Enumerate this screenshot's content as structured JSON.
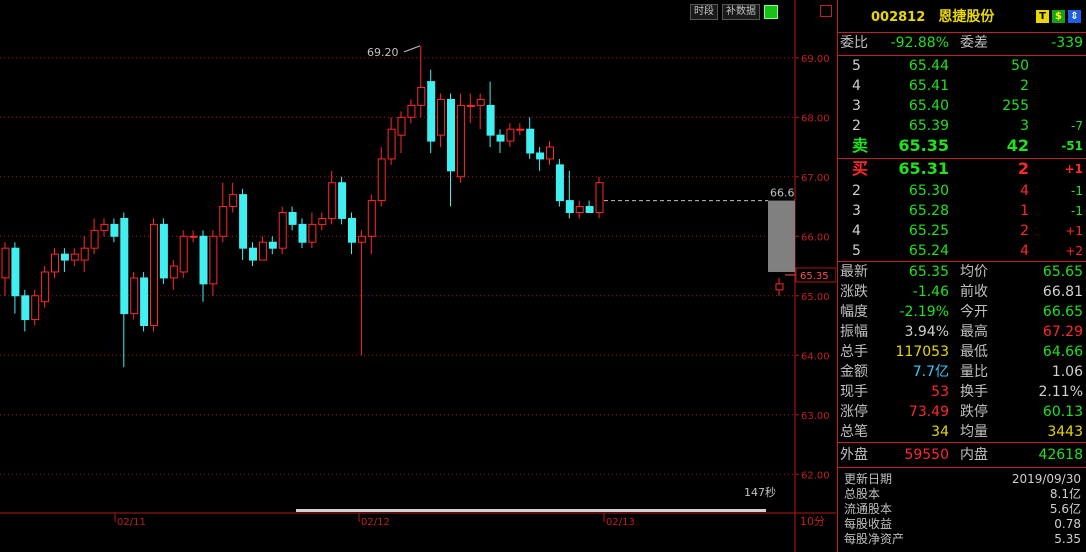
{
  "toolbar": {
    "period_label": "时段",
    "fill_data_label": "补数据"
  },
  "header": {
    "code": "002812",
    "name": "恩捷股份",
    "icons": [
      "T-icon",
      "green-dollar-icon",
      "blue-arrow-icon"
    ]
  },
  "chart_data": {
    "type": "candlestick",
    "ylim": [
      61.5,
      69.4
    ],
    "y_ticks": [
      "69.00",
      "68.00",
      "67.00",
      "66.00",
      "65.00",
      "64.00",
      "63.00",
      "62.00"
    ],
    "x_labels": [
      "02/11",
      "02/12",
      "02/13"
    ],
    "period_label": "10分",
    "countdown": "147秒",
    "max_label": "69.20",
    "current_price_label": "65.35",
    "dashed_label": "66.6",
    "bars": [
      {
        "o": 65.3,
        "c": 65.8,
        "h": 65.9,
        "l": 65.0
      },
      {
        "o": 65.8,
        "c": 65.0,
        "h": 65.9,
        "l": 64.7
      },
      {
        "o": 65.0,
        "c": 64.6,
        "h": 65.1,
        "l": 64.4
      },
      {
        "o": 64.6,
        "c": 65.0,
        "h": 65.1,
        "l": 64.5
      },
      {
        "o": 64.9,
        "c": 65.4,
        "h": 65.5,
        "l": 64.8
      },
      {
        "o": 65.4,
        "c": 65.7,
        "h": 65.8,
        "l": 65.3
      },
      {
        "o": 65.7,
        "c": 65.6,
        "h": 65.8,
        "l": 65.4
      },
      {
        "o": 65.6,
        "c": 65.7,
        "h": 65.8,
        "l": 65.5
      },
      {
        "o": 65.6,
        "c": 65.8,
        "h": 66.0,
        "l": 65.4
      },
      {
        "o": 65.8,
        "c": 66.1,
        "h": 66.3,
        "l": 65.7
      },
      {
        "o": 66.1,
        "c": 66.2,
        "h": 66.3,
        "l": 66.0
      },
      {
        "o": 66.2,
        "c": 66.0,
        "h": 66.3,
        "l": 65.9
      },
      {
        "o": 66.3,
        "c": 64.7,
        "h": 66.4,
        "l": 63.8
      },
      {
        "o": 64.7,
        "c": 65.3,
        "h": 65.4,
        "l": 64.6
      },
      {
        "o": 65.3,
        "c": 64.5,
        "h": 65.4,
        "l": 64.4
      },
      {
        "o": 64.5,
        "c": 66.2,
        "h": 66.3,
        "l": 64.4
      },
      {
        "o": 66.2,
        "c": 65.3,
        "h": 66.3,
        "l": 65.2
      },
      {
        "o": 65.3,
        "c": 65.5,
        "h": 65.6,
        "l": 65.1
      },
      {
        "o": 65.4,
        "c": 66.0,
        "h": 66.1,
        "l": 65.3
      },
      {
        "o": 66.0,
        "c": 66.0,
        "h": 66.1,
        "l": 65.9
      },
      {
        "o": 66.0,
        "c": 65.2,
        "h": 66.1,
        "l": 64.9
      },
      {
        "o": 65.2,
        "c": 66.0,
        "h": 66.1,
        "l": 65.0
      },
      {
        "o": 66.0,
        "c": 66.5,
        "h": 66.9,
        "l": 65.9
      },
      {
        "o": 66.5,
        "c": 66.7,
        "h": 66.9,
        "l": 66.4
      },
      {
        "o": 66.7,
        "c": 65.8,
        "h": 66.8,
        "l": 65.6
      },
      {
        "o": 65.8,
        "c": 65.6,
        "h": 65.9,
        "l": 65.5
      },
      {
        "o": 65.6,
        "c": 65.9,
        "h": 66.0,
        "l": 65.6
      },
      {
        "o": 65.9,
        "c": 65.8,
        "h": 66.0,
        "l": 65.7
      },
      {
        "o": 65.8,
        "c": 66.4,
        "h": 66.5,
        "l": 65.7
      },
      {
        "o": 66.4,
        "c": 66.2,
        "h": 66.5,
        "l": 66.1
      },
      {
        "o": 66.2,
        "c": 65.9,
        "h": 66.3,
        "l": 65.8
      },
      {
        "o": 65.9,
        "c": 66.2,
        "h": 66.4,
        "l": 65.8
      },
      {
        "o": 66.2,
        "c": 66.3,
        "h": 66.4,
        "l": 66.1
      },
      {
        "o": 66.3,
        "c": 66.9,
        "h": 67.1,
        "l": 66.2
      },
      {
        "o": 66.9,
        "c": 66.3,
        "h": 67.0,
        "l": 66.2
      },
      {
        "o": 66.3,
        "c": 65.9,
        "h": 66.4,
        "l": 65.7
      },
      {
        "o": 65.9,
        "c": 66.0,
        "h": 66.1,
        "l": 64.0
      },
      {
        "o": 66.0,
        "c": 66.6,
        "h": 66.7,
        "l": 65.7
      },
      {
        "o": 66.6,
        "c": 67.3,
        "h": 67.5,
        "l": 66.5
      },
      {
        "o": 67.3,
        "c": 67.8,
        "h": 68.0,
        "l": 67.2
      },
      {
        "o": 67.7,
        "c": 68.0,
        "h": 68.1,
        "l": 67.4
      },
      {
        "o": 68.0,
        "c": 68.2,
        "h": 68.3,
        "l": 67.9
      },
      {
        "o": 68.2,
        "c": 68.5,
        "h": 69.2,
        "l": 68.0
      },
      {
        "o": 68.6,
        "c": 67.6,
        "h": 68.8,
        "l": 67.4
      },
      {
        "o": 67.7,
        "c": 68.3,
        "h": 68.4,
        "l": 67.5
      },
      {
        "o": 68.3,
        "c": 67.1,
        "h": 68.4,
        "l": 66.5
      },
      {
        "o": 67.0,
        "c": 68.2,
        "h": 68.4,
        "l": 66.9
      },
      {
        "o": 68.2,
        "c": 68.2,
        "h": 68.4,
        "l": 67.9
      },
      {
        "o": 68.2,
        "c": 68.3,
        "h": 68.4,
        "l": 67.8
      },
      {
        "o": 68.2,
        "c": 67.7,
        "h": 68.6,
        "l": 67.5
      },
      {
        "o": 67.7,
        "c": 67.6,
        "h": 67.8,
        "l": 67.4
      },
      {
        "o": 67.6,
        "c": 67.8,
        "h": 67.9,
        "l": 67.5
      },
      {
        "o": 67.8,
        "c": 67.8,
        "h": 67.9,
        "l": 67.7
      },
      {
        "o": 67.8,
        "c": 67.4,
        "h": 68.0,
        "l": 67.3
      },
      {
        "o": 67.4,
        "c": 67.3,
        "h": 67.5,
        "l": 67.1
      },
      {
        "o": 67.3,
        "c": 67.5,
        "h": 67.6,
        "l": 67.2
      },
      {
        "o": 67.2,
        "c": 66.6,
        "h": 67.3,
        "l": 66.5
      },
      {
        "o": 66.6,
        "c": 66.4,
        "h": 67.1,
        "l": 66.3
      },
      {
        "o": 66.4,
        "c": 66.5,
        "h": 66.6,
        "l": 66.3
      },
      {
        "o": 66.5,
        "c": 66.4,
        "h": 66.6,
        "l": 66.4
      },
      {
        "o": 66.4,
        "c": 66.9,
        "h": 67.0,
        "l": 66.3
      },
      {
        "o": 65.1,
        "c": 65.2,
        "h": 65.3,
        "l": 65.0
      }
    ]
  },
  "order_book": {
    "ratio_label": "委比",
    "ratio": "-92.88%",
    "diff_label": "委差",
    "diff": "-339",
    "asks": [
      {
        "level": "5",
        "price": "65.44",
        "vol": "50",
        "chg": ""
      },
      {
        "level": "4",
        "price": "65.41",
        "vol": "2",
        "chg": ""
      },
      {
        "level": "3",
        "price": "65.40",
        "vol": "255",
        "chg": ""
      },
      {
        "level": "2",
        "price": "65.39",
        "vol": "3",
        "chg": "-7"
      },
      {
        "level": "卖",
        "price": "65.35",
        "vol": "42",
        "chg": "-51"
      }
    ],
    "bids": [
      {
        "level": "买",
        "price": "65.31",
        "vol": "2",
        "chg": "+1"
      },
      {
        "level": "2",
        "price": "65.30",
        "vol": "4",
        "chg": "-1"
      },
      {
        "level": "3",
        "price": "65.28",
        "vol": "1",
        "chg": "-1"
      },
      {
        "level": "4",
        "price": "65.25",
        "vol": "2",
        "chg": "+1"
      },
      {
        "level": "5",
        "price": "65.24",
        "vol": "4",
        "chg": "+2"
      }
    ]
  },
  "quote": [
    {
      "l1": "最新",
      "v1": "65.35",
      "c1": "g",
      "l2": "均价",
      "v2": "65.65",
      "c2": "g"
    },
    {
      "l1": "涨跌",
      "v1": "-1.46",
      "c1": "g",
      "l2": "前收",
      "v2": "66.81",
      "c2": "w"
    },
    {
      "l1": "幅度",
      "v1": "-2.19%",
      "c1": "g",
      "l2": "今开",
      "v2": "66.65",
      "c2": "g"
    },
    {
      "l1": "振幅",
      "v1": "3.94%",
      "c1": "w",
      "l2": "最高",
      "v2": "67.29",
      "c2": "r"
    },
    {
      "l1": "总手",
      "v1": "117053",
      "c1": "y",
      "l2": "最低",
      "v2": "64.66",
      "c2": "g"
    },
    {
      "l1": "金额",
      "v1": "7.7亿",
      "c1": "c",
      "l2": "量比",
      "v2": "1.06",
      "c2": "w"
    },
    {
      "l1": "现手",
      "v1": "53",
      "c1": "r",
      "l2": "换手",
      "v2": "2.11%",
      "c2": "w"
    },
    {
      "l1": "涨停",
      "v1": "73.49",
      "c1": "r",
      "l2": "跌停",
      "v2": "60.13",
      "c2": "g"
    },
    {
      "l1": "总笔",
      "v1": "34",
      "c1": "y",
      "l2": "均量",
      "v2": "3443",
      "c2": "y"
    }
  ],
  "outer_inner": {
    "out_label": "外盘",
    "out": "59550",
    "in_label": "内盘",
    "in": "42618"
  },
  "info": [
    {
      "label": "更新日期",
      "value": "2019/09/30"
    },
    {
      "label": "总股本",
      "value": "8.1亿"
    },
    {
      "label": "流通股本",
      "value": "5.6亿"
    },
    {
      "label": "每股收益",
      "value": "0.78"
    },
    {
      "label": "每股净资产",
      "value": "5.35"
    }
  ],
  "colors": {
    "up": "#ff2828",
    "down": "#40f0f0",
    "grid": "#b01818",
    "label": "#c02020"
  }
}
